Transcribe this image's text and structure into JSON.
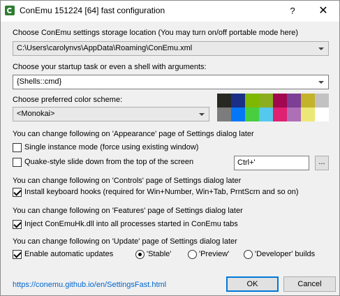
{
  "window": {
    "title": "ConEmu 151224 [64] fast configuration",
    "help_label": "?",
    "close_label": "✕"
  },
  "storage": {
    "label": "Choose ConEmu settings storage location (You may turn on/off portable mode here)",
    "value": "C:\\Users\\carolynvs\\AppData\\Roaming\\ConEmu.xml"
  },
  "startup": {
    "label": "Choose your startup task or even a shell with arguments:",
    "value": "{Shells::cmd}"
  },
  "color_scheme": {
    "label": "Choose preferred color scheme:",
    "value": "<Monokai>",
    "palette_row1": [
      "#272822",
      "#1b2f87",
      "#7fb800",
      "#8bae20",
      "#a10850",
      "#7d3e96",
      "#c3b32b",
      "#c2c2c2"
    ],
    "palette_row2": [
      "#7c7c7c",
      "#0477f6",
      "#48ce3e",
      "#54c8ee",
      "#e02071",
      "#ad6fb6",
      "#ece878",
      "#ffffff"
    ]
  },
  "appearance": {
    "section_label": "You can change following on 'Appearance' page of Settings dialog later",
    "single_instance_label": "Single instance mode (force using existing window)",
    "single_instance_checked": false,
    "quake_label": "Quake-style slide down from the top of the screen",
    "quake_checked": false,
    "hotkey_value": "Ctrl+'",
    "browse_label": "..."
  },
  "controls": {
    "section_label": "You can change following on 'Controls' page of Settings dialog later",
    "hooks_label": "Install keyboard hooks (required for Win+Number, Win+Tab, PrntScrn and so on)",
    "hooks_checked": true
  },
  "features": {
    "section_label": "You can change following on 'Features' page of Settings dialog later",
    "inject_label": "Inject ConEmuHk.dll into all processes started in ConEmu tabs",
    "inject_checked": true
  },
  "update": {
    "section_label": "You can change following on 'Update' page of Settings dialog later",
    "auto_label": "Enable automatic updates",
    "auto_checked": true,
    "stable_label": "'Stable'",
    "preview_label": "'Preview'",
    "developer_label": "'Developer' builds",
    "selected_channel": "stable"
  },
  "footer": {
    "link_text": "https://conemu.github.io/en/SettingsFast.html",
    "ok_label": "OK",
    "cancel_label": "Cancel"
  }
}
